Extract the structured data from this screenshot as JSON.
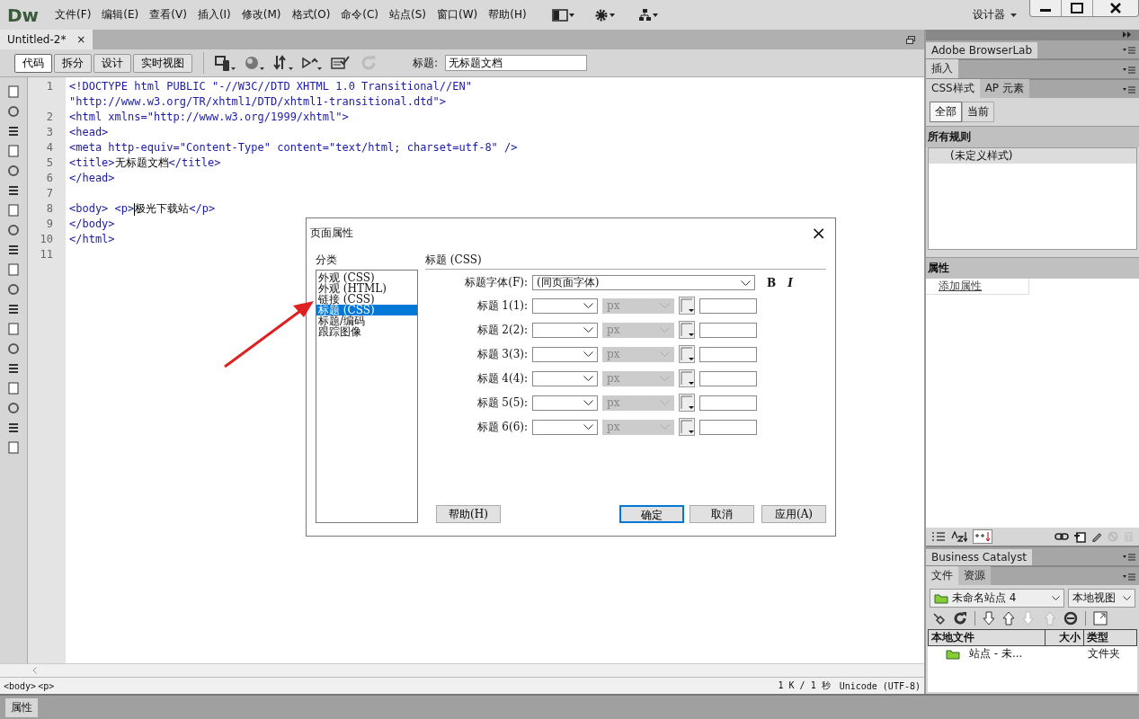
{
  "app": {
    "logo": "Dw",
    "menu": [
      "文件(F)",
      "编辑(E)",
      "查看(V)",
      "插入(I)",
      "修改(M)",
      "格式(O)",
      "命令(C)",
      "站点(S)",
      "窗口(W)",
      "帮助(H)"
    ],
    "workspace": "设计器"
  },
  "document_tab": {
    "title": "Untitled-2*",
    "close": "×"
  },
  "view_buttons": [
    {
      "label": "代码",
      "selected": true
    },
    {
      "label": "拆分",
      "selected": false
    },
    {
      "label": "设计",
      "selected": false
    },
    {
      "label": "实时视图",
      "selected": false
    }
  ],
  "title_field": {
    "label": "标题:",
    "value": "无标题文档"
  },
  "code": [
    {
      "number": "1",
      "segments": [
        {
          "kind": "tag",
          "text": "<!DOCTYPE html PUBLIC \"-//W3C//DTD XHTML 1.0 Transitional//EN\""
        }
      ]
    },
    {
      "segments": [
        {
          "kind": "tag",
          "text": "\"http://www.w3.org/TR/xhtml1/DTD/xhtml1-transitional.dtd\">"
        }
      ]
    },
    {
      "number": "2",
      "segments": [
        {
          "kind": "tag",
          "text": "<html xmlns=\"http://www.w3.org/1999/xhtml\">"
        }
      ]
    },
    {
      "number": "3",
      "segments": [
        {
          "kind": "tag",
          "text": "<head>"
        }
      ]
    },
    {
      "number": "4",
      "segments": [
        {
          "kind": "tag",
          "text": "<meta http-equiv=\"Content-Type\" content=\"text/html; charset=utf-8\" />"
        }
      ]
    },
    {
      "number": "5",
      "segments": [
        {
          "kind": "tag",
          "text": "<title>"
        },
        {
          "kind": "text",
          "text": "无标题文档"
        },
        {
          "kind": "tag",
          "text": "</title>"
        }
      ]
    },
    {
      "number": "6",
      "segments": [
        {
          "kind": "tag",
          "text": "</head>"
        }
      ]
    },
    {
      "number": "7"
    },
    {
      "number": "8",
      "segments": [
        {
          "kind": "tag",
          "text": "<body> <p>"
        },
        {
          "kind": "cursor"
        },
        {
          "kind": "text",
          "text": "极光下载站"
        },
        {
          "kind": "tag",
          "text": "</p>"
        }
      ]
    },
    {
      "number": "9",
      "segments": [
        {
          "kind": "tag",
          "text": "</body>"
        }
      ]
    },
    {
      "number": "10",
      "segments": [
        {
          "kind": "tag",
          "text": "</html>"
        }
      ]
    },
    {
      "number": "11"
    }
  ],
  "dialog": {
    "title": "页面属性",
    "close": "×",
    "category_label": "分类",
    "categories": [
      {
        "label": "外观 (CSS)",
        "selected": false
      },
      {
        "label": "外观 (HTML)",
        "selected": false
      },
      {
        "label": "链接 (CSS)",
        "selected": false
      },
      {
        "label": "标题 (CSS)",
        "selected": true
      },
      {
        "label": "标题/编码",
        "selected": false
      },
      {
        "label": "跟踪图像",
        "selected": false
      }
    ],
    "section_title": "标题 (CSS)",
    "font_label": "标题字体(F):",
    "font_value": "(同页面字体)",
    "bold": "B",
    "italic": "I",
    "headings": [
      {
        "label": "标题 1(1):",
        "unit": "px",
        "unit_disabled": true
      },
      {
        "label": "标题 2(2):",
        "unit": "px",
        "unit_disabled": true
      },
      {
        "label": "标题 3(3):",
        "unit": "px",
        "unit_disabled": true
      },
      {
        "label": "标题 4(4):",
        "unit": "px",
        "unit_disabled": true
      },
      {
        "label": "标题 5(5):",
        "unit": "px",
        "unit_disabled": true
      },
      {
        "label": "标题 6(6):",
        "unit": "px",
        "unit_disabled": true
      }
    ],
    "buttons": {
      "help": "帮助(H)",
      "ok": "确定",
      "cancel": "取消",
      "apply": "应用(A)"
    }
  },
  "right_panel": {
    "browserlab": "Adobe BrowserLab",
    "insert": "插入",
    "css_tabs": [
      {
        "label": "CSS样式",
        "selected": true
      },
      {
        "label": "AP 元素",
        "selected": false
      }
    ],
    "css_modes": [
      {
        "label": "全部",
        "selected": true
      },
      {
        "label": "当前",
        "selected": false
      }
    ],
    "rules_header": "所有规则",
    "rules": [
      "(未定义样式)"
    ],
    "properties_header": "属性",
    "add_property": "添加属性",
    "business_catalyst": "Business Catalyst",
    "file_tabs": [
      {
        "label": "文件",
        "selected": true
      },
      {
        "label": "资源",
        "selected": false
      }
    ],
    "site": "未命名站点 4",
    "view": "本地视图",
    "columns": [
      "本地文件",
      "大小",
      "类型"
    ],
    "files": [
      {
        "name": "站点 - 未...",
        "type": "文件夹"
      }
    ]
  },
  "status_bar": {
    "tags": [
      "<body>",
      "<p>"
    ],
    "size": "1 K / 1 秒",
    "encoding": "Unicode (UTF-8)"
  },
  "bottom_tab": "属性"
}
